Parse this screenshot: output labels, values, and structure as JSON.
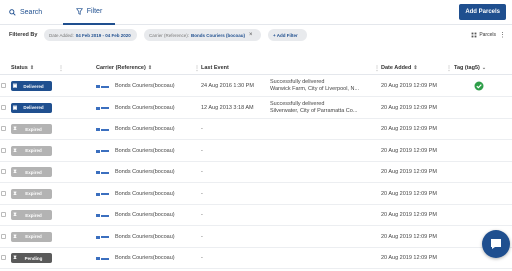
{
  "tabs": {
    "search": "Search",
    "filter": "Filter"
  },
  "add_parcels_label": "Add Parcels",
  "filters": {
    "label": "Filtered By",
    "chips": [
      {
        "key": "Date Added:",
        "value": "04 Feb 2019 - 04 Feb 2020"
      },
      {
        "key": "Carrier (Reference):",
        "value": "Bonds Couriers (bocoau)"
      }
    ],
    "add_filter": "+ Add Filter",
    "parcels_label": "Parcels"
  },
  "columns": {
    "status": "Status",
    "carrier": "Carrier (Reference)",
    "last_event": "Last Event",
    "date_added": "Date Added",
    "tag": "Tag (tag5)"
  },
  "colors": {
    "delivered": "#1f4f8f",
    "expired": "#b3b3b3",
    "pending": "#5a5a5a",
    "accent": "#1f4f8f",
    "success": "#2e9e49"
  },
  "rows": [
    {
      "status": "Delivered",
      "status_type": "delivered",
      "carrier": "Bonds Couriers(bocoau)",
      "last_event": "24 Aug 2016 1:30 PM",
      "event_line1": "Successfully delivered",
      "event_line2": "Warwick Farm, City of Liverpool, N...",
      "date_added": "20 Aug 2019 12:09 PM",
      "tag": true
    },
    {
      "status": "Delivered",
      "status_type": "delivered",
      "carrier": "Bonds Couriers(bocoau)",
      "last_event": "12 Aug 2013 3:18 AM",
      "event_line1": "Successfully delivered",
      "event_line2": "Silverwater, City of Parramatta Co...",
      "date_added": "20 Aug 2019 12:09 PM",
      "tag": false
    },
    {
      "status": "Expired",
      "status_type": "expired",
      "carrier": "Bonds Couriers(bocoau)",
      "last_event": "-",
      "event_line1": "",
      "event_line2": "",
      "date_added": "20 Aug 2019 12:09 PM",
      "tag": false
    },
    {
      "status": "Expired",
      "status_type": "expired",
      "carrier": "Bonds Couriers(bocoau)",
      "last_event": "-",
      "event_line1": "",
      "event_line2": "",
      "date_added": "20 Aug 2019 12:09 PM",
      "tag": false
    },
    {
      "status": "Expired",
      "status_type": "expired",
      "carrier": "Bonds Couriers(bocoau)",
      "last_event": "-",
      "event_line1": "",
      "event_line2": "",
      "date_added": "20 Aug 2019 12:09 PM",
      "tag": false
    },
    {
      "status": "Expired",
      "status_type": "expired",
      "carrier": "Bonds Couriers(bocoau)",
      "last_event": "-",
      "event_line1": "",
      "event_line2": "",
      "date_added": "20 Aug 2019 12:09 PM",
      "tag": false
    },
    {
      "status": "Expired",
      "status_type": "expired",
      "carrier": "Bonds Couriers(bocoau)",
      "last_event": "-",
      "event_line1": "",
      "event_line2": "",
      "date_added": "20 Aug 2019 12:09 PM",
      "tag": false
    },
    {
      "status": "Expired",
      "status_type": "expired",
      "carrier": "Bonds Couriers(bocoau)",
      "last_event": "-",
      "event_line1": "",
      "event_line2": "",
      "date_added": "20 Aug 2019 12:09 PM",
      "tag": false
    },
    {
      "status": "Pending",
      "status_type": "pending",
      "carrier": "Bonds Couriers(bocoau)",
      "last_event": "-",
      "event_line1": "",
      "event_line2": "",
      "date_added": "20 Aug 2019 12:09 PM",
      "tag": false
    }
  ]
}
